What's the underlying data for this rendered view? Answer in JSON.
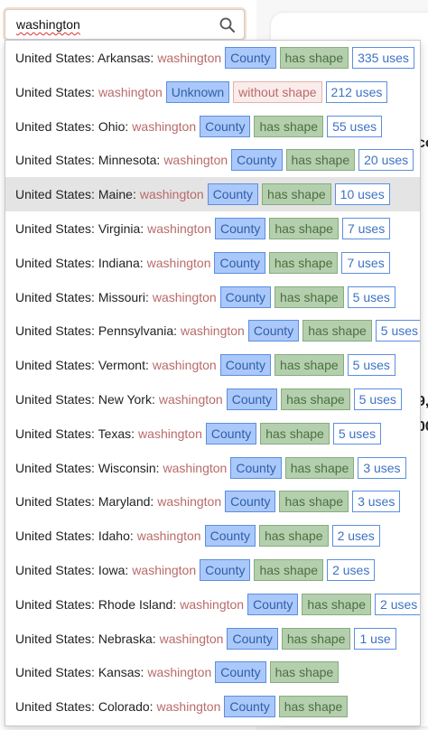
{
  "search": {
    "value": "washington"
  },
  "background": {
    "fragments": [
      "co",
      "9,",
      "00"
    ]
  },
  "results": [
    {
      "place": "United States: Arkansas:",
      "name": "washington",
      "type": "County",
      "shape": "has shape",
      "shape_kind": "has",
      "uses": "335 uses",
      "highlighted": false
    },
    {
      "place": "United States:",
      "name": "washington",
      "type": "Unknown",
      "shape": "without shape",
      "shape_kind": "without",
      "uses": "212 uses",
      "highlighted": false
    },
    {
      "place": "United States: Ohio:",
      "name": "washington",
      "type": "County",
      "shape": "has shape",
      "shape_kind": "has",
      "uses": "55 uses",
      "highlighted": false
    },
    {
      "place": "United States: Minnesota:",
      "name": "washington",
      "type": "County",
      "shape": "has shape",
      "shape_kind": "has",
      "uses": "20 uses",
      "highlighted": false
    },
    {
      "place": "United States: Maine:",
      "name": "washington",
      "type": "County",
      "shape": "has shape",
      "shape_kind": "has",
      "uses": "10 uses",
      "highlighted": true
    },
    {
      "place": "United States: Virginia:",
      "name": "washington",
      "type": "County",
      "shape": "has shape",
      "shape_kind": "has",
      "uses": "7 uses",
      "highlighted": false
    },
    {
      "place": "United States: Indiana:",
      "name": "washington",
      "type": "County",
      "shape": "has shape",
      "shape_kind": "has",
      "uses": "7 uses",
      "highlighted": false
    },
    {
      "place": "United States: Missouri:",
      "name": "washington",
      "type": "County",
      "shape": "has shape",
      "shape_kind": "has",
      "uses": "5 uses",
      "highlighted": false
    },
    {
      "place": "United States: Pennsylvania:",
      "name": "washington",
      "type": "County",
      "shape": "has shape",
      "shape_kind": "has",
      "uses": "5 uses",
      "highlighted": false
    },
    {
      "place": "United States: Vermont:",
      "name": "washington",
      "type": "County",
      "shape": "has shape",
      "shape_kind": "has",
      "uses": "5 uses",
      "highlighted": false
    },
    {
      "place": "United States: New York:",
      "name": "washington",
      "type": "County",
      "shape": "has shape",
      "shape_kind": "has",
      "uses": "5 uses",
      "highlighted": false
    },
    {
      "place": "United States: Texas:",
      "name": "washington",
      "type": "County",
      "shape": "has shape",
      "shape_kind": "has",
      "uses": "5 uses",
      "highlighted": false
    },
    {
      "place": "United States: Wisconsin:",
      "name": "washington",
      "type": "County",
      "shape": "has shape",
      "shape_kind": "has",
      "uses": "3 uses",
      "highlighted": false
    },
    {
      "place": "United States: Maryland:",
      "name": "washington",
      "type": "County",
      "shape": "has shape",
      "shape_kind": "has",
      "uses": "3 uses",
      "highlighted": false
    },
    {
      "place": "United States: Idaho:",
      "name": "washington",
      "type": "County",
      "shape": "has shape",
      "shape_kind": "has",
      "uses": "2 uses",
      "highlighted": false
    },
    {
      "place": "United States: Iowa:",
      "name": "washington",
      "type": "County",
      "shape": "has shape",
      "shape_kind": "has",
      "uses": "2 uses",
      "highlighted": false
    },
    {
      "place": "United States: Rhode Island:",
      "name": "washington",
      "type": "County",
      "shape": "has shape",
      "shape_kind": "has",
      "uses": "2 uses",
      "highlighted": false
    },
    {
      "place": "United States: Nebraska:",
      "name": "washington",
      "type": "County",
      "shape": "has shape",
      "shape_kind": "has",
      "uses": "1 use",
      "highlighted": false
    },
    {
      "place": "United States: Kansas:",
      "name": "washington",
      "type": "County",
      "shape": "has shape",
      "shape_kind": "has",
      "uses": "",
      "highlighted": false
    },
    {
      "place": "United States: Colorado:",
      "name": "washington",
      "type": "County",
      "shape": "has shape",
      "shape_kind": "has",
      "uses": "",
      "highlighted": false
    }
  ]
}
